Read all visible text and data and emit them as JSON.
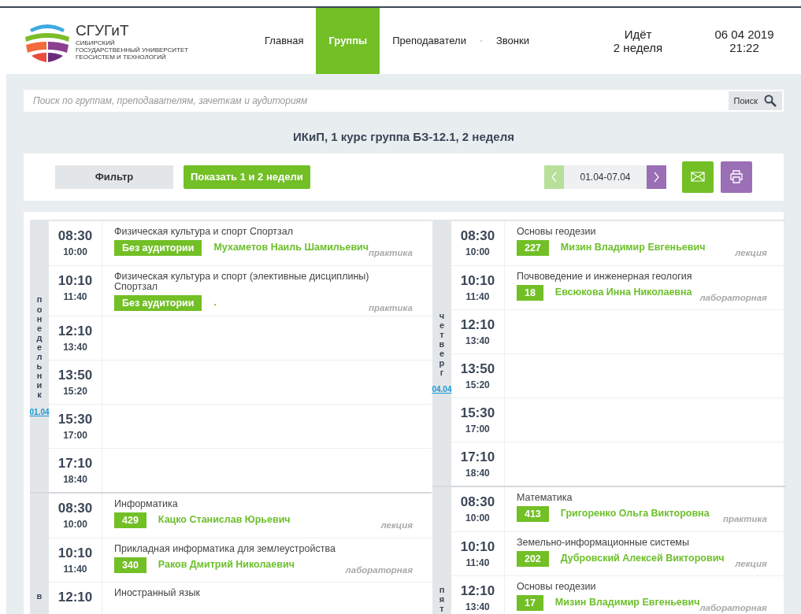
{
  "header": {
    "logo": {
      "name": "СГУГиТ",
      "subtitle_lines": [
        "СИБИРСКИЙ",
        "ГОСУДАРСТВЕННЫЙ УНИВЕРСИТЕТ",
        "ГЕОСИСТЕМ И ТЕХНОЛОГИЙ"
      ]
    },
    "nav": [
      {
        "label": "Главная",
        "selected": false
      },
      {
        "label": "Группы",
        "selected": true
      },
      {
        "label": "Преподаватели",
        "selected": false
      },
      {
        "label": "Звонки",
        "selected": false
      }
    ],
    "week_status": [
      "Идёт",
      "2 неделя"
    ],
    "datetime": {
      "date": "06 04 2019",
      "time": "21:22"
    }
  },
  "search": {
    "placeholder": "Поиск по группам, преподавателям, зачеткам и аудиториям",
    "button": "Поиск"
  },
  "title": "ИКиП, 1 курс группа БЗ-12.1, 2 неделя",
  "toolbar": {
    "filter": "Фильтр",
    "show_weeks": "Показать 1 и 2 недели",
    "range": {
      "label": "01.04-07.04",
      "prev_disabled": true,
      "next_disabled": false
    }
  },
  "columns": [
    [
      {
        "name": "понедельник",
        "date": "01.04",
        "slots": [
          {
            "start": "08:30",
            "end": "10:00",
            "lesson": {
              "title": "Физическая культура и спорт Спортзал",
              "room": "Без аудитории",
              "teacher": "Мухаметов Наиль Шамильевич",
              "type": "практика"
            }
          },
          {
            "start": "10:10",
            "end": "11:40",
            "lesson": {
              "title": "Физическая культура и спорт (элективные дисциплины) Спортзал",
              "room": "Без аудитории",
              "teacher": ".",
              "type": "практика"
            }
          },
          {
            "start": "12:10",
            "end": "13:40"
          },
          {
            "start": "13:50",
            "end": "15:20"
          },
          {
            "start": "15:30",
            "end": "17:00"
          },
          {
            "start": "17:10",
            "end": "18:40"
          }
        ]
      },
      {
        "name": "в",
        "slots": [
          {
            "start": "08:30",
            "end": "10:00",
            "lesson": {
              "title": "Информатика",
              "room": "429",
              "teacher": "Кацко Станислав Юрьевич",
              "type": "лекция"
            }
          },
          {
            "start": "10:10",
            "end": "11:40",
            "lesson": {
              "title": "Прикладная информатика для землеустройства",
              "room": "340",
              "teacher": "Раков Дмитрий Николаевич",
              "type": "лабораторная"
            }
          },
          {
            "start": "12:10",
            "lesson": {
              "title": "Иностранный язык"
            }
          }
        ]
      }
    ],
    [
      {
        "name": "четверг",
        "date": "04.04",
        "slots": [
          {
            "start": "08:30",
            "end": "10:00",
            "lesson": {
              "title": "Основы геодезии",
              "room": "227",
              "teacher": "Мизин Владимир Евгеньевич",
              "type": "лекция"
            }
          },
          {
            "start": "10:10",
            "end": "11:40",
            "lesson": {
              "title": "Почвоведение и инженерная геология",
              "room": "18",
              "teacher": "Евсюкова Инна Николаевна",
              "type": "лабораторная"
            }
          },
          {
            "start": "12:10",
            "end": "13:40"
          },
          {
            "start": "13:50",
            "end": "15:20"
          },
          {
            "start": "15:30",
            "end": "17:00"
          },
          {
            "start": "17:10",
            "end": "18:40"
          }
        ]
      },
      {
        "name": "пят",
        "slots": [
          {
            "start": "08:30",
            "end": "10:00",
            "lesson": {
              "title": "Математика",
              "room": "413",
              "teacher": "Григоренко Ольга Викторовна",
              "type": "практика"
            }
          },
          {
            "start": "10:10",
            "end": "11:40",
            "lesson": {
              "title": "Земельно-информационные системы",
              "room": "202",
              "teacher": "Дубровский Алексей Викторович",
              "type": "лекция"
            }
          },
          {
            "start": "12:10",
            "end": "13:40",
            "lesson": {
              "title": "Основы геодезии",
              "room": "17",
              "teacher": "Мизин Владимир Евгеньевич",
              "type": "лабораторная"
            }
          }
        ]
      }
    ]
  ]
}
